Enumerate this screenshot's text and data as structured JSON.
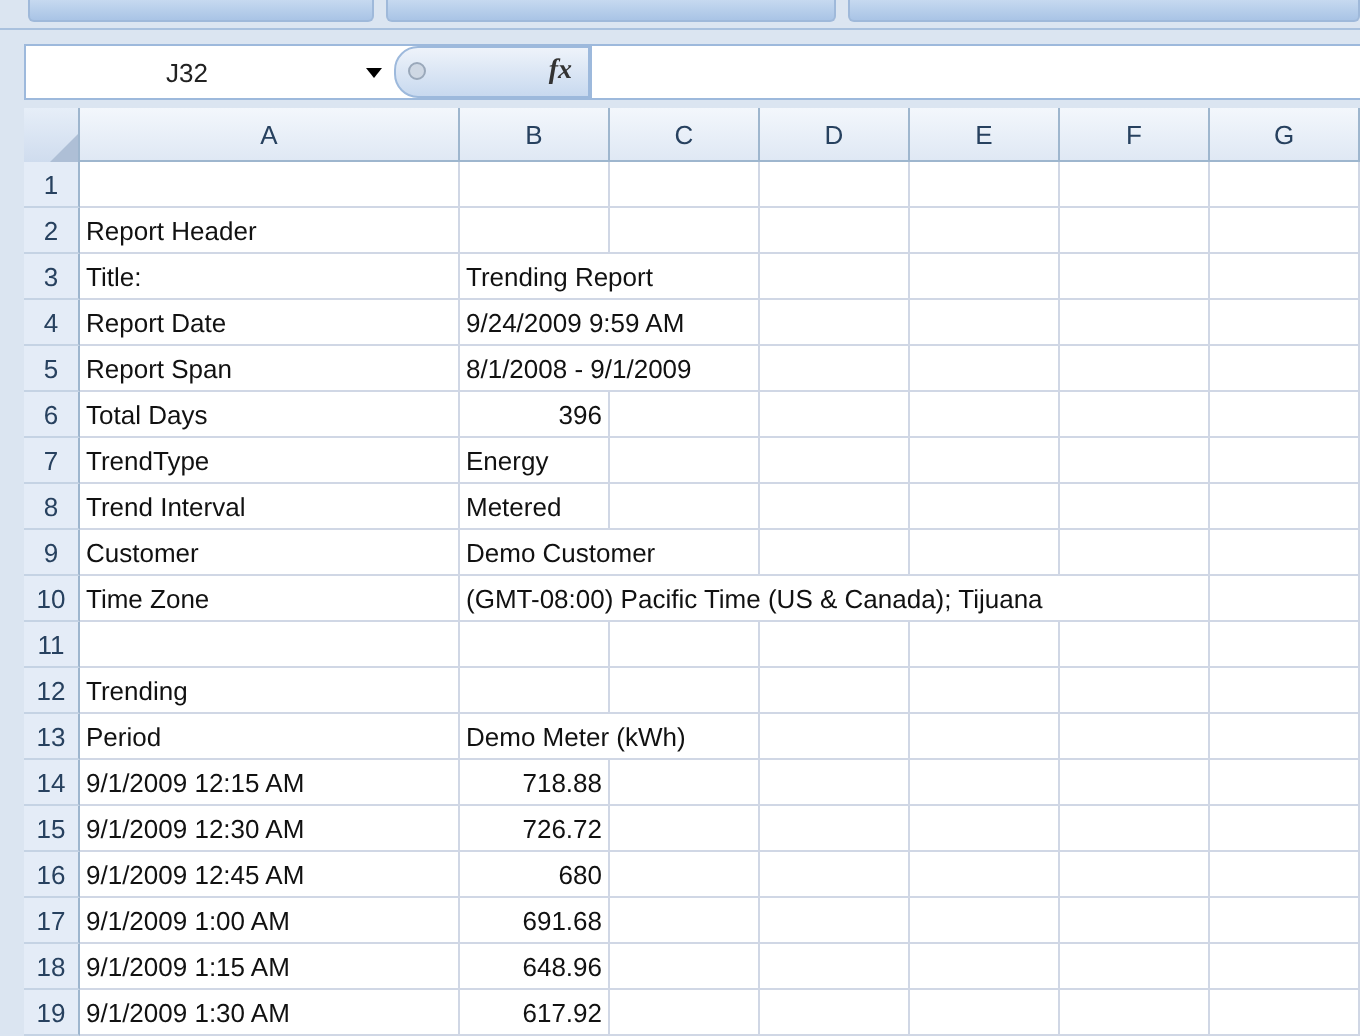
{
  "name_box": "J32",
  "formula_button": "fx",
  "columns": [
    "A",
    "B",
    "C",
    "D",
    "E",
    "F",
    "G"
  ],
  "rows": [
    {
      "number": "1"
    },
    {
      "number": "2",
      "label": "Report Header"
    },
    {
      "number": "3",
      "label": "Title:",
      "value": "Trending Report",
      "kind": "text"
    },
    {
      "number": "4",
      "label": "Report Date",
      "value": "9/24/2009 9:59 AM",
      "kind": "text"
    },
    {
      "number": "5",
      "label": "Report Span",
      "value": "8/1/2008 - 9/1/2009",
      "kind": "text"
    },
    {
      "number": "6",
      "label": "Total Days",
      "value": "396",
      "kind": "number"
    },
    {
      "number": "7",
      "label": "TrendType",
      "value": "Energy",
      "kind": "text"
    },
    {
      "number": "8",
      "label": "Trend Interval",
      "value": "Metered",
      "kind": "text"
    },
    {
      "number": "9",
      "label": "Customer",
      "value": "Demo Customer",
      "kind": "text"
    },
    {
      "number": "10",
      "label": "Time Zone",
      "value": "(GMT-08:00) Pacific Time (US & Canada); Tijuana",
      "kind": "text"
    },
    {
      "number": "11"
    },
    {
      "number": "12",
      "label": "Trending"
    },
    {
      "number": "13",
      "label": "Period",
      "value": "Demo Meter (kWh)",
      "kind": "text"
    },
    {
      "number": "14",
      "label": "9/1/2009 12:15 AM",
      "value": "718.88",
      "kind": "number"
    },
    {
      "number": "15",
      "label": "9/1/2009 12:30 AM",
      "value": "726.72",
      "kind": "number"
    },
    {
      "number": "16",
      "label": "9/1/2009 12:45 AM",
      "value": "680",
      "kind": "number"
    },
    {
      "number": "17",
      "label": "9/1/2009 1:00 AM",
      "value": "691.68",
      "kind": "number"
    },
    {
      "number": "18",
      "label": "9/1/2009 1:15 AM",
      "value": "648.96",
      "kind": "number"
    },
    {
      "number": "19",
      "label": "9/1/2009 1:30 AM",
      "value": "617.92",
      "kind": "number"
    }
  ]
}
